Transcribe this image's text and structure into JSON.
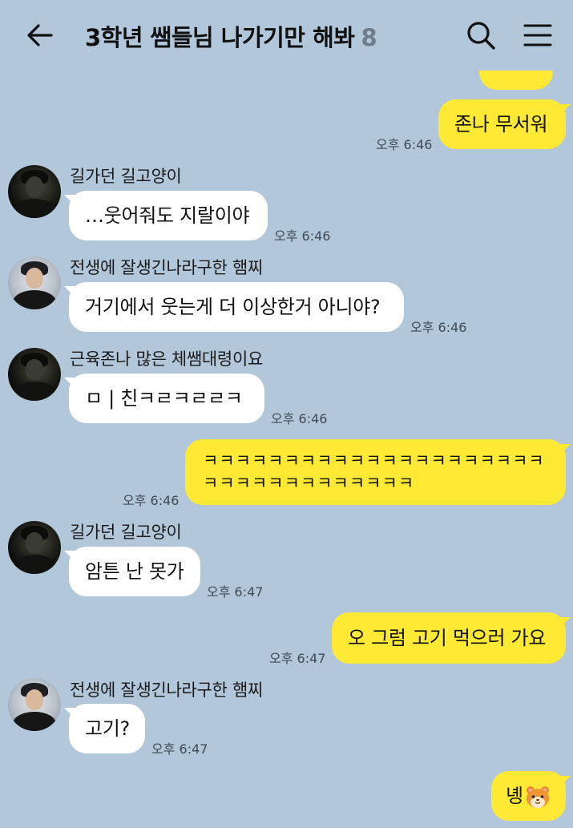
{
  "header": {
    "back_icon": "arrow-left-icon",
    "title": "3학년 쌤들님 나가기만 해봐",
    "member_count": "8",
    "search_icon": "search-icon",
    "menu_icon": "hamburger-menu-icon"
  },
  "messages": [
    {
      "side": "out",
      "text": "",
      "time": ""
    },
    {
      "side": "out",
      "text": "존나 무서워",
      "time": "오후 6:46"
    },
    {
      "side": "in",
      "sender": "길가던 길고양이",
      "avatar": "dark",
      "text": "…웃어줘도 지랄이야",
      "time": "오후 6:46"
    },
    {
      "side": "in",
      "sender": "전생에 잘생긴나라구한 햄찌",
      "avatar": "light",
      "text": "거기에서 웃는게 더 이상한거 아니야?",
      "time": "오후 6:46"
    },
    {
      "side": "in",
      "sender": "근육존나 많은 체쌤대령이요",
      "avatar": "dark",
      "text": "ㅁ | 친ㅋㄹㅋㄹㄹㅋ",
      "time": "오후 6:46"
    },
    {
      "side": "out",
      "text": "ㅋㅋㅋㅋㅋㅋㅋㅋㅋㅋㅋㅋㅋㅋㅋㅋㅋㅋㅋㅋㅋㅋㅋㅋㅋㅋㅋㅋㅋㅋㅋㅋㅋㅋ",
      "time": "오후 6:46"
    },
    {
      "side": "in",
      "sender": "길가던 길고양이",
      "avatar": "dark",
      "text": "암튼 난 못가",
      "time": "오후 6:47"
    },
    {
      "side": "out",
      "text": "오 그럼 고기 먹으러 가요",
      "time": "오후 6:47"
    },
    {
      "side": "in",
      "sender": "전생에 잘생긴나라구한 햄찌",
      "avatar": "light",
      "text": "고기?",
      "time": "오후 6:47"
    },
    {
      "side": "out",
      "text": "녱",
      "emoji": "hamster-face-emoji",
      "time": ""
    }
  ],
  "colors": {
    "background": "#b2c7da",
    "incoming_bubble": "#ffffff",
    "outgoing_bubble": "#fee934",
    "time_text": "#3e4a56",
    "member_count": "#6e7d8c"
  }
}
